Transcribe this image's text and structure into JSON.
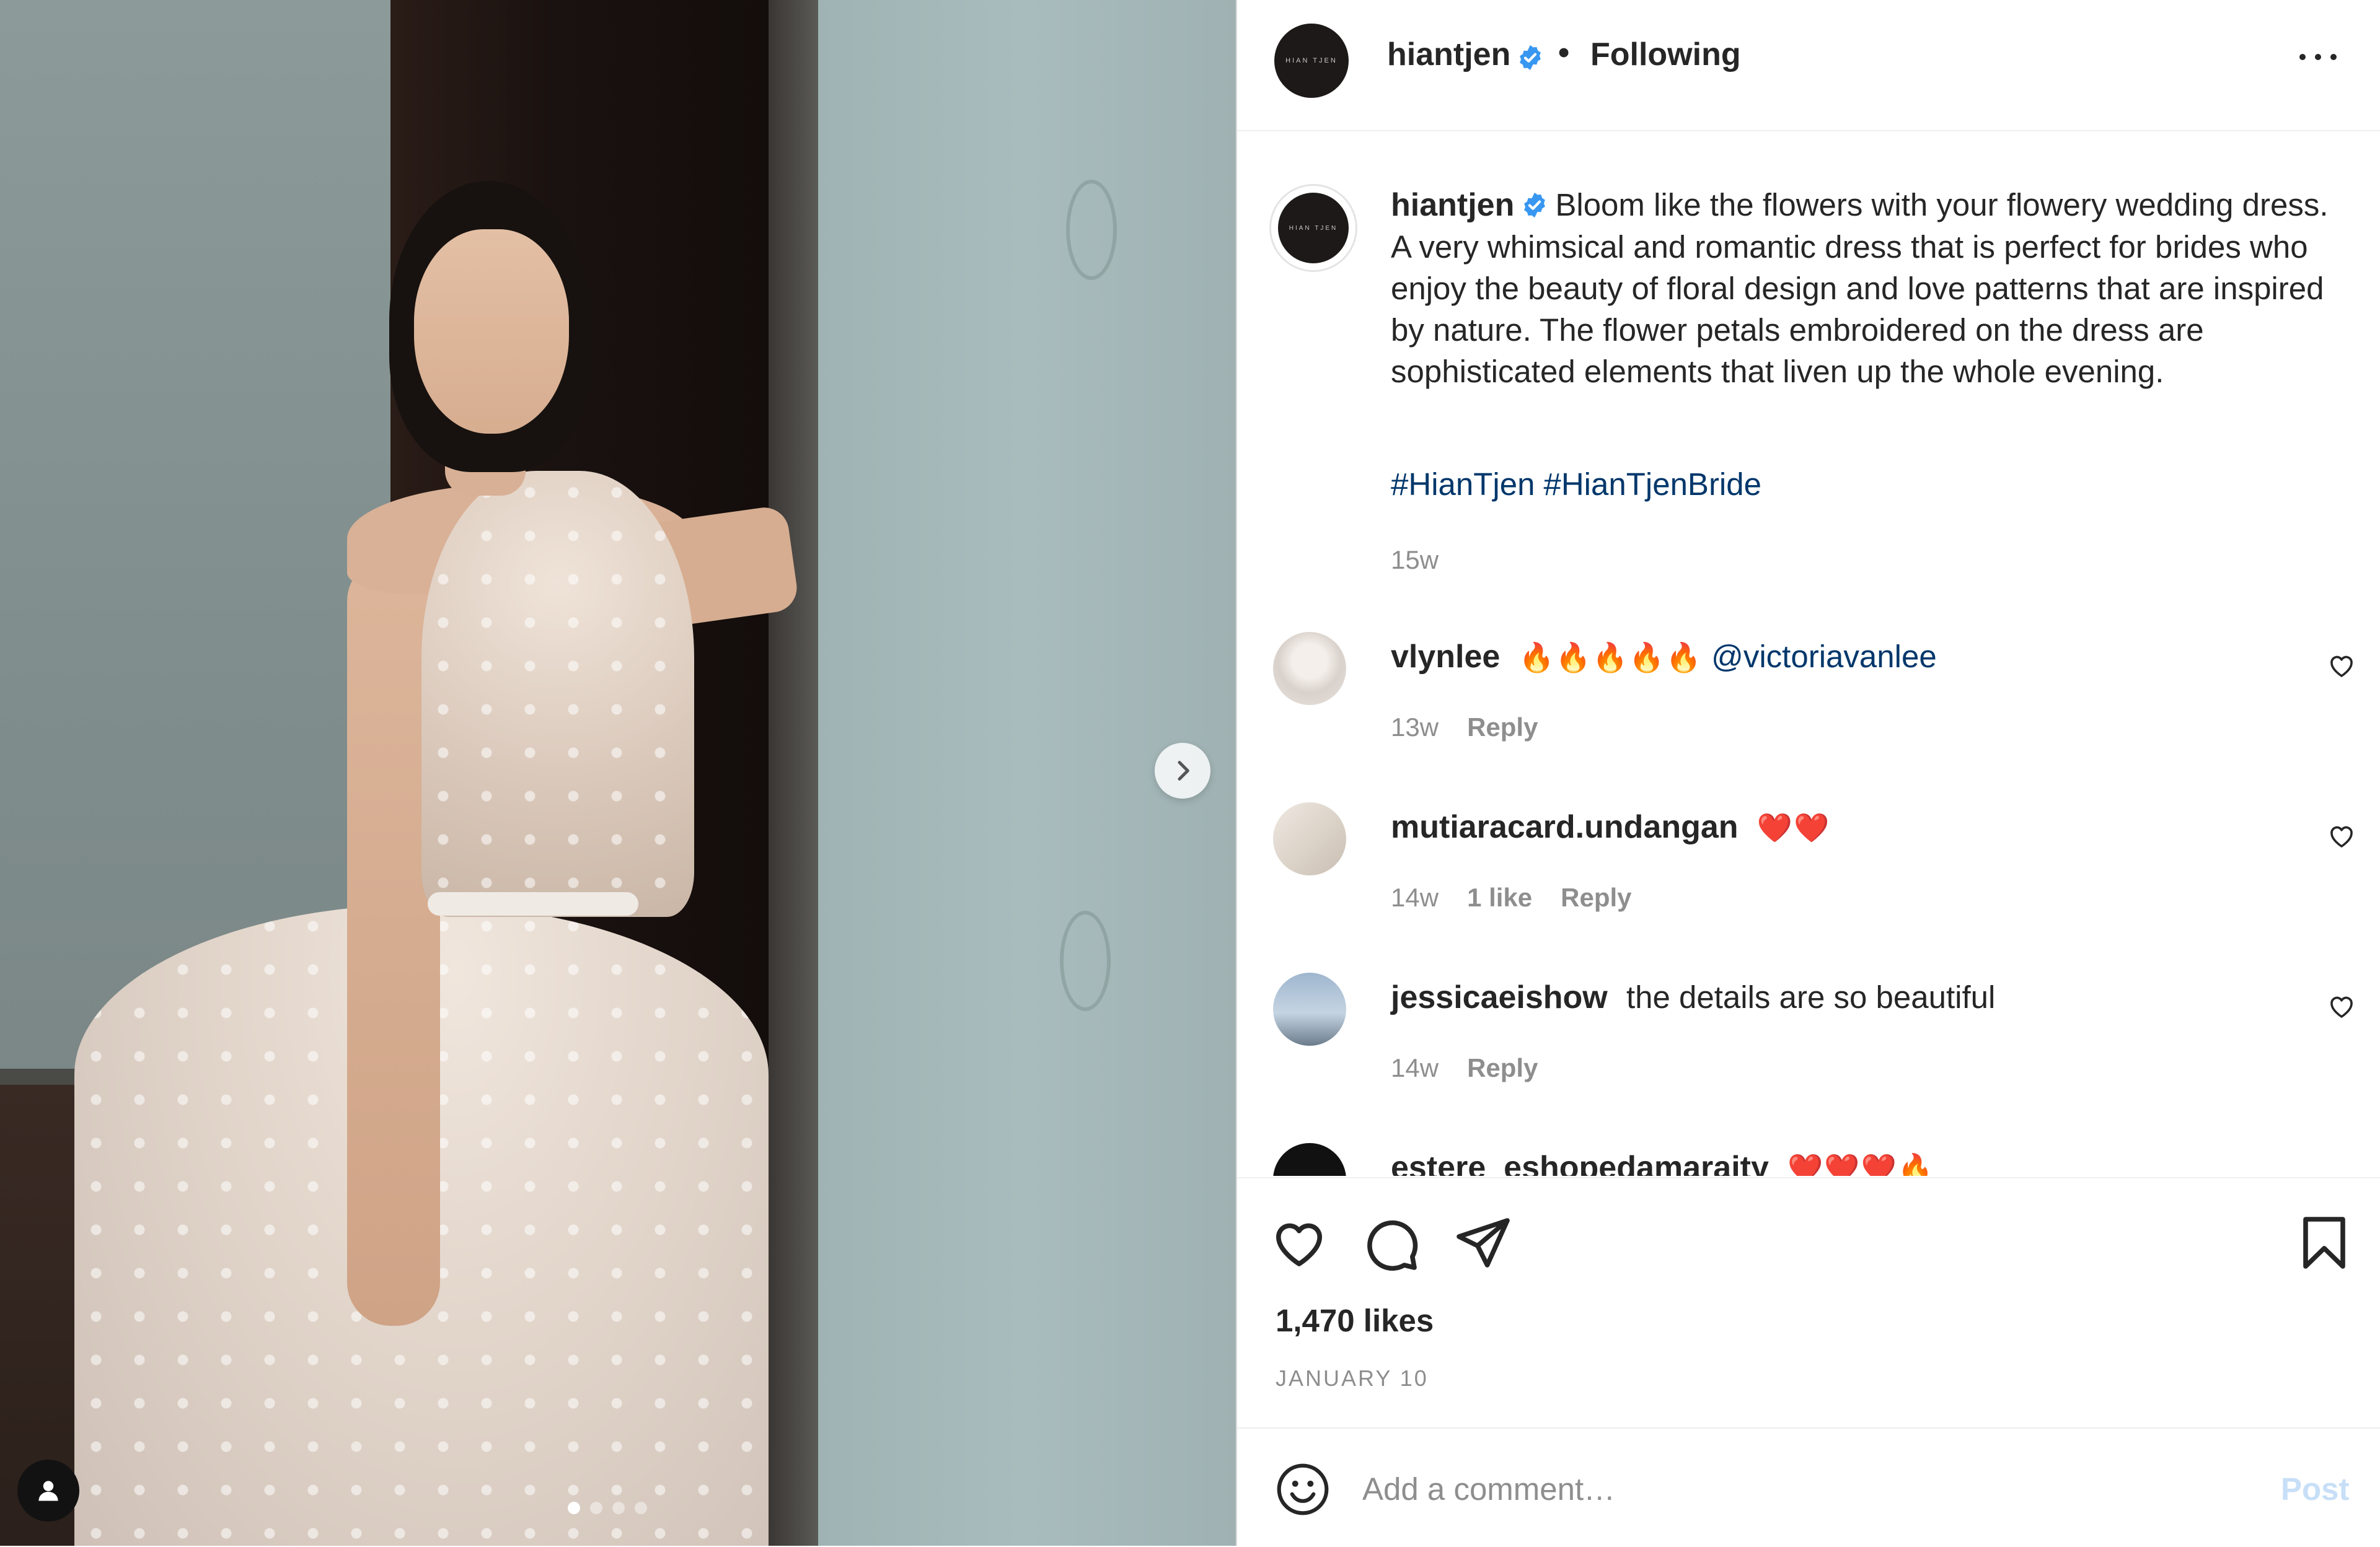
{
  "post": {
    "author": "hiantjen",
    "follow_status": "Following",
    "header_separator": "•",
    "brand_avatar_text": "HIAN TJEN",
    "caption": "Bloom like the flowers with your flowery wedding dress. A very whimsical and romantic dress that is perfect for brides who enjoy the beauty of floral design and love patterns that are inspired by nature. The flower petals embroidered on the dress are sophisticated elements that liven up the whole evening.",
    "hashtags": [
      "#HianTjen",
      "#HianTjenBride"
    ],
    "caption_time": "15w",
    "likes": "1,470 likes",
    "date": "JANUARY 10"
  },
  "carousel": {
    "slide_count": 4,
    "active_slide": 1
  },
  "comments": [
    {
      "user": "vlynlee",
      "emoji": "🔥🔥🔥🔥🔥",
      "mention": "@victoriavanlee",
      "text": "",
      "time": "13w",
      "likes": "",
      "reply": "Reply"
    },
    {
      "user": "mutiaracard.undangan",
      "emoji": "❤️❤️",
      "mention": "",
      "text": "",
      "time": "14w",
      "likes": "1 like",
      "reply": "Reply"
    },
    {
      "user": "jessicaeishow",
      "emoji": "",
      "mention": "",
      "text": "the details are so beautiful",
      "time": "14w",
      "likes": "",
      "reply": "Reply"
    },
    {
      "user": "estere_eshopedamaraity",
      "emoji": "❤️❤️❤️🔥",
      "mention": "",
      "text": "",
      "time": "",
      "likes": "",
      "reply": ""
    }
  ],
  "add_comment": {
    "placeholder": "Add a comment…",
    "post_label": "Post"
  },
  "icons": {
    "verified": "verified-badge-icon",
    "more": "more-options-icon",
    "next": "chevron-right-icon",
    "like": "heart-icon",
    "comment": "comment-bubble-icon",
    "share": "paper-plane-icon",
    "save": "bookmark-icon",
    "emoji": "smiley-face-icon",
    "tag": "user-tag-icon"
  },
  "colors": {
    "verified_blue": "#3897f0",
    "link_blue": "#00376b",
    "muted": "#8e8e8e",
    "post_disabled": "#c7dff7"
  }
}
